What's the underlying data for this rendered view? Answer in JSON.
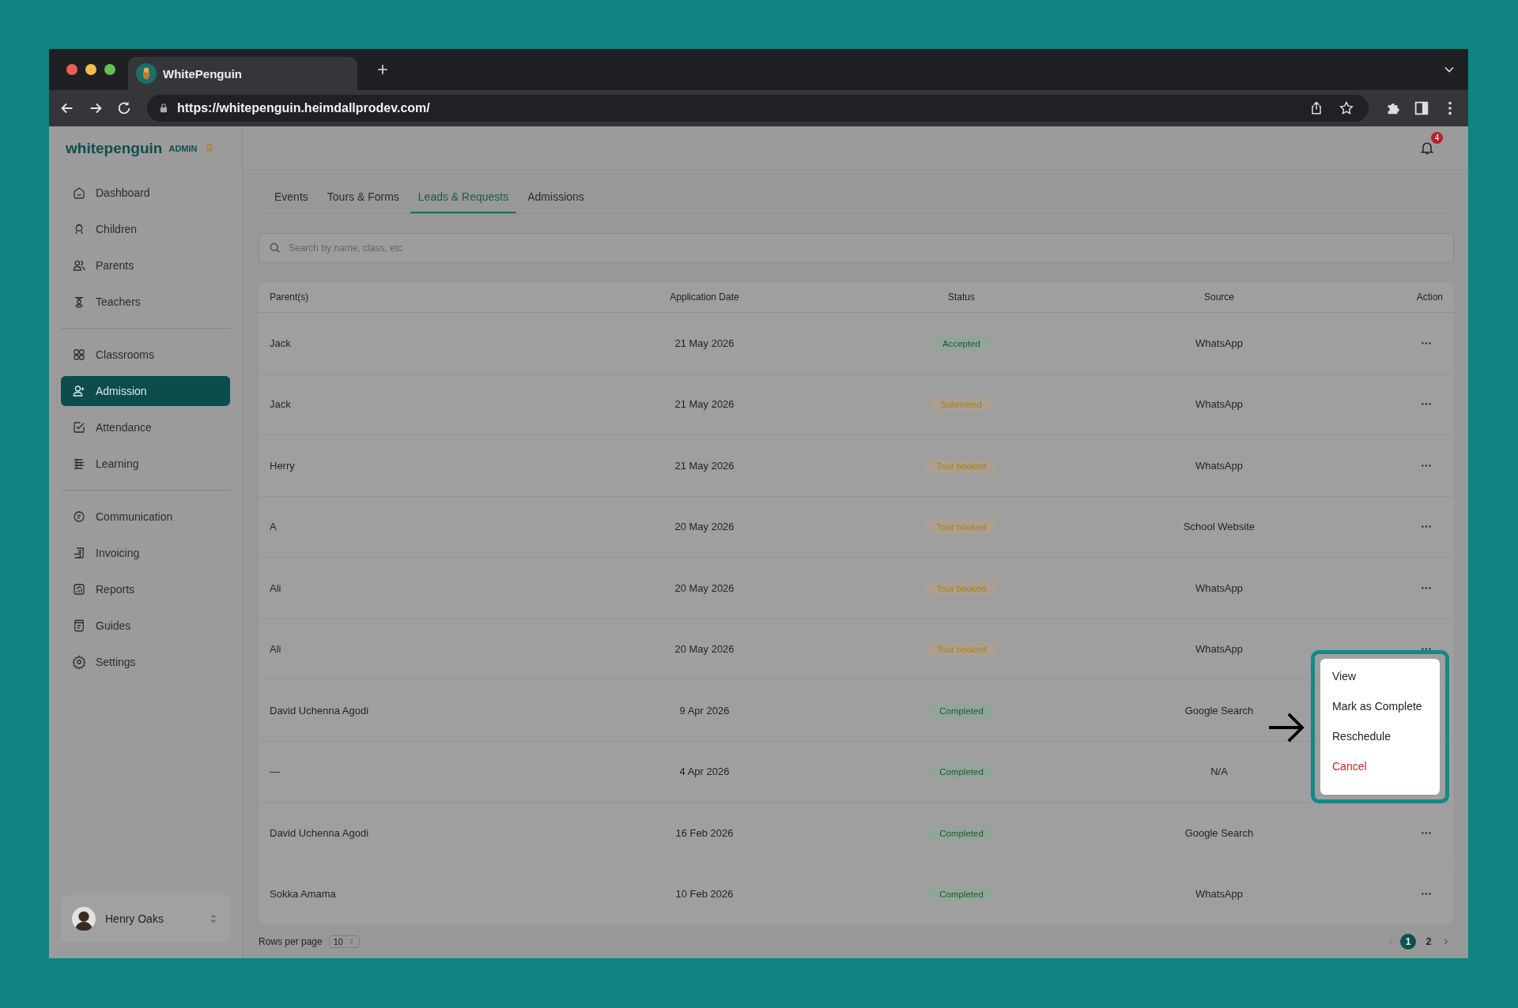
{
  "browser": {
    "tab_title": "WhitePenguin",
    "url": "https://whitepenguin.heimdallprodev.com/"
  },
  "sidebar": {
    "logo": "whitepenguin",
    "role": "ADMIN",
    "groups": [
      [
        {
          "label": "Dashboard",
          "selected": false
        },
        {
          "label": "Children",
          "selected": false
        },
        {
          "label": "Parents",
          "selected": false
        },
        {
          "label": "Teachers",
          "selected": false
        }
      ],
      [
        {
          "label": "Classrooms",
          "selected": false
        },
        {
          "label": "Admission",
          "selected": true
        },
        {
          "label": "Attendance",
          "selected": false
        },
        {
          "label": "Learning",
          "selected": false
        }
      ],
      [
        {
          "label": "Communication",
          "selected": false
        },
        {
          "label": "Invoicing",
          "selected": false
        },
        {
          "label": "Reports",
          "selected": false
        },
        {
          "label": "Guides",
          "selected": false
        },
        {
          "label": "Settings",
          "selected": false
        }
      ]
    ],
    "user": {
      "name": "Henry Oaks"
    }
  },
  "header": {
    "notification_count": "4"
  },
  "tabs": [
    {
      "label": "Events",
      "selected": false
    },
    {
      "label": "Tours & Forms",
      "selected": false
    },
    {
      "label": "Leads & Requests",
      "selected": true
    },
    {
      "label": "Admissions",
      "selected": false
    }
  ],
  "search": {
    "placeholder": "Search by name, class, etc"
  },
  "table": {
    "columns": [
      "Parent(s)",
      "Application Date",
      "Status",
      "Source",
      "Action"
    ],
    "rows": [
      {
        "parent": "Jack",
        "date": "21 May 2026",
        "status": {
          "label": "Accepted",
          "kind": "success"
        },
        "source": "WhatsApp"
      },
      {
        "parent": "Jack",
        "date": "21 May 2026",
        "status": {
          "label": "Submitted",
          "kind": "warning"
        },
        "source": "WhatsApp"
      },
      {
        "parent": "Herry",
        "date": "21 May 2026",
        "status": {
          "label": "Tour booked",
          "kind": "warning"
        },
        "source": "WhatsApp"
      },
      {
        "parent": "A",
        "date": "20 May 2026",
        "status": {
          "label": "Tour booked",
          "kind": "warning"
        },
        "source": "School Website"
      },
      {
        "parent": "Ali",
        "date": "20 May 2026",
        "status": {
          "label": "Tour booked",
          "kind": "warning"
        },
        "source": "WhatsApp"
      },
      {
        "parent": "Ali",
        "date": "20 May 2026",
        "status": {
          "label": "Tour booked",
          "kind": "warning"
        },
        "source": "WhatsApp"
      },
      {
        "parent": "David Uchenna Agodi",
        "date": "9 Apr 2026",
        "status": {
          "label": "Completed",
          "kind": "success"
        },
        "source": "Google Search"
      },
      {
        "parent": "—",
        "date": "4 Apr 2026",
        "status": {
          "label": "Completed",
          "kind": "success"
        },
        "source": "N/A"
      },
      {
        "parent": "David Uchenna Agodi",
        "date": "16 Feb 2026",
        "status": {
          "label": "Completed",
          "kind": "success"
        },
        "source": "Google Search"
      },
      {
        "parent": "Sokka Amama",
        "date": "10 Feb 2026",
        "status": {
          "label": "Completed",
          "kind": "success"
        },
        "source": "WhatsApp"
      }
    ]
  },
  "action_menu": {
    "items": [
      {
        "label": "View",
        "kind": "normal"
      },
      {
        "label": "Mark as Complete",
        "kind": "normal"
      },
      {
        "label": "Reschedule",
        "kind": "normal"
      },
      {
        "label": "Cancel",
        "kind": "danger"
      }
    ]
  },
  "pagination": {
    "rows_per_page_label": "Rows per page",
    "rows_per_page": "10",
    "pages": [
      {
        "label": "1",
        "selected": true
      },
      {
        "label": "2",
        "selected": false
      }
    ]
  }
}
